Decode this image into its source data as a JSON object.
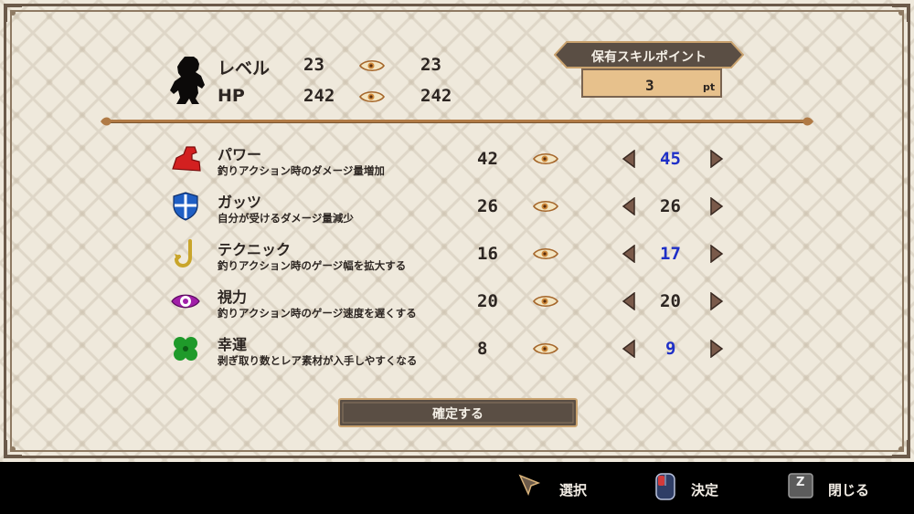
{
  "header": {
    "level_label": "レベル",
    "level_current": "23",
    "level_next": "23",
    "hp_label": "HP",
    "hp_current": "242",
    "hp_next": "242"
  },
  "skill_points": {
    "title": "保有スキルポイント",
    "value": "3",
    "unit": "pt"
  },
  "stats": [
    {
      "name": "パワー",
      "desc": "釣りアクション時のダメージ量増加",
      "current": "42",
      "next": "45",
      "changed": true,
      "icon": "muscle-arm-icon",
      "color": "#d32020"
    },
    {
      "name": "ガッツ",
      "desc": "自分が受けるダメージ量減少",
      "current": "26",
      "next": "26",
      "changed": false,
      "icon": "shield-icon",
      "color": "#1f5fc4"
    },
    {
      "name": "テクニック",
      "desc": "釣りアクション時のゲージ幅を拡大する",
      "current": "16",
      "next": "17",
      "changed": true,
      "icon": "fishhook-icon",
      "color": "#c9a52b"
    },
    {
      "name": "視力",
      "desc": "釣りアクション時のゲージ速度を遅くする",
      "current": "20",
      "next": "20",
      "changed": false,
      "icon": "eye-icon",
      "color": "#a11fa8"
    },
    {
      "name": "幸運",
      "desc": "剥ぎ取り数とレア素材が入手しやすくなる",
      "current": "8",
      "next": "9",
      "changed": true,
      "icon": "four-leaf-clover-icon",
      "color": "#1f9a2a"
    }
  ],
  "confirm_label": "確定する",
  "footer": {
    "select_label": "選択",
    "decide_label": "決定",
    "close_label": "閉じる",
    "close_key": "Z"
  },
  "colors": {
    "changed_value": "#1e2fc7",
    "panel_bg": "#efe9dc",
    "frame": "#6b5a4a",
    "button_bg": "#5a4e44"
  }
}
